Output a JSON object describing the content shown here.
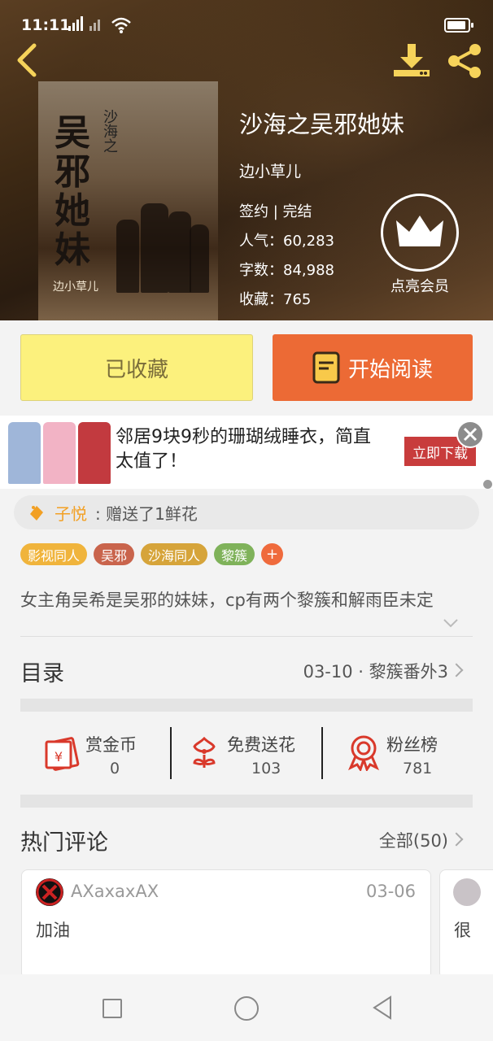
{
  "status_bar": {
    "time": "11:11",
    "signal_text": "4G   ✕"
  },
  "book": {
    "title": "沙海之吴邪她妹",
    "author": "边小草儿",
    "status": "签约 | 完结",
    "popularity": "人气：60,283",
    "word_count": "字数：84,988",
    "favorites": "收藏：765",
    "cover": {
      "subtitle": "沙海之",
      "title_big": "吴邪她妹",
      "author_mark": "边小草儿"
    }
  },
  "vip": {
    "label": "点亮会员"
  },
  "actions": {
    "collected_label": "已收藏",
    "read_label": "开始阅读"
  },
  "ad": {
    "text": "邻居9块9秒的珊瑚绒睡衣，简直太值了！",
    "cta": "立即下载"
  },
  "gift": {
    "user": "子悦",
    "message": ": 赠送了1鲜花"
  },
  "tags": [
    {
      "label": "影视同人",
      "color": "#f0b43c"
    },
    {
      "label": "吴邪",
      "color": "#c9644c"
    },
    {
      "label": "沙海同人",
      "color": "#d6a43a"
    },
    {
      "label": "黎簇",
      "color": "#7fb25a"
    }
  ],
  "description": "女主角吴希是吴邪的妹妹，cp有两个黎簇和解雨臣未定",
  "toc": {
    "title": "目录",
    "latest": "03-10 · 黎簇番外3"
  },
  "stats": [
    {
      "label": "赏金币",
      "value": "0",
      "icon": "red-envelope-icon"
    },
    {
      "label": "免费送花",
      "value": "103",
      "icon": "flower-icon"
    },
    {
      "label": "粉丝榜",
      "value": "781",
      "icon": "medal-icon"
    }
  ],
  "comments": {
    "title": "热门评论",
    "all_label": "全部(50)",
    "items": [
      {
        "user": "AXaxaxAX",
        "date": "03-06",
        "text": "加油"
      },
      {
        "user": "",
        "date": "",
        "text": "很"
      }
    ]
  },
  "colors": {
    "accent_orange": "#ec6a35",
    "collected_yellow": "#fcf17d",
    "ad_red": "#c83c3c"
  }
}
